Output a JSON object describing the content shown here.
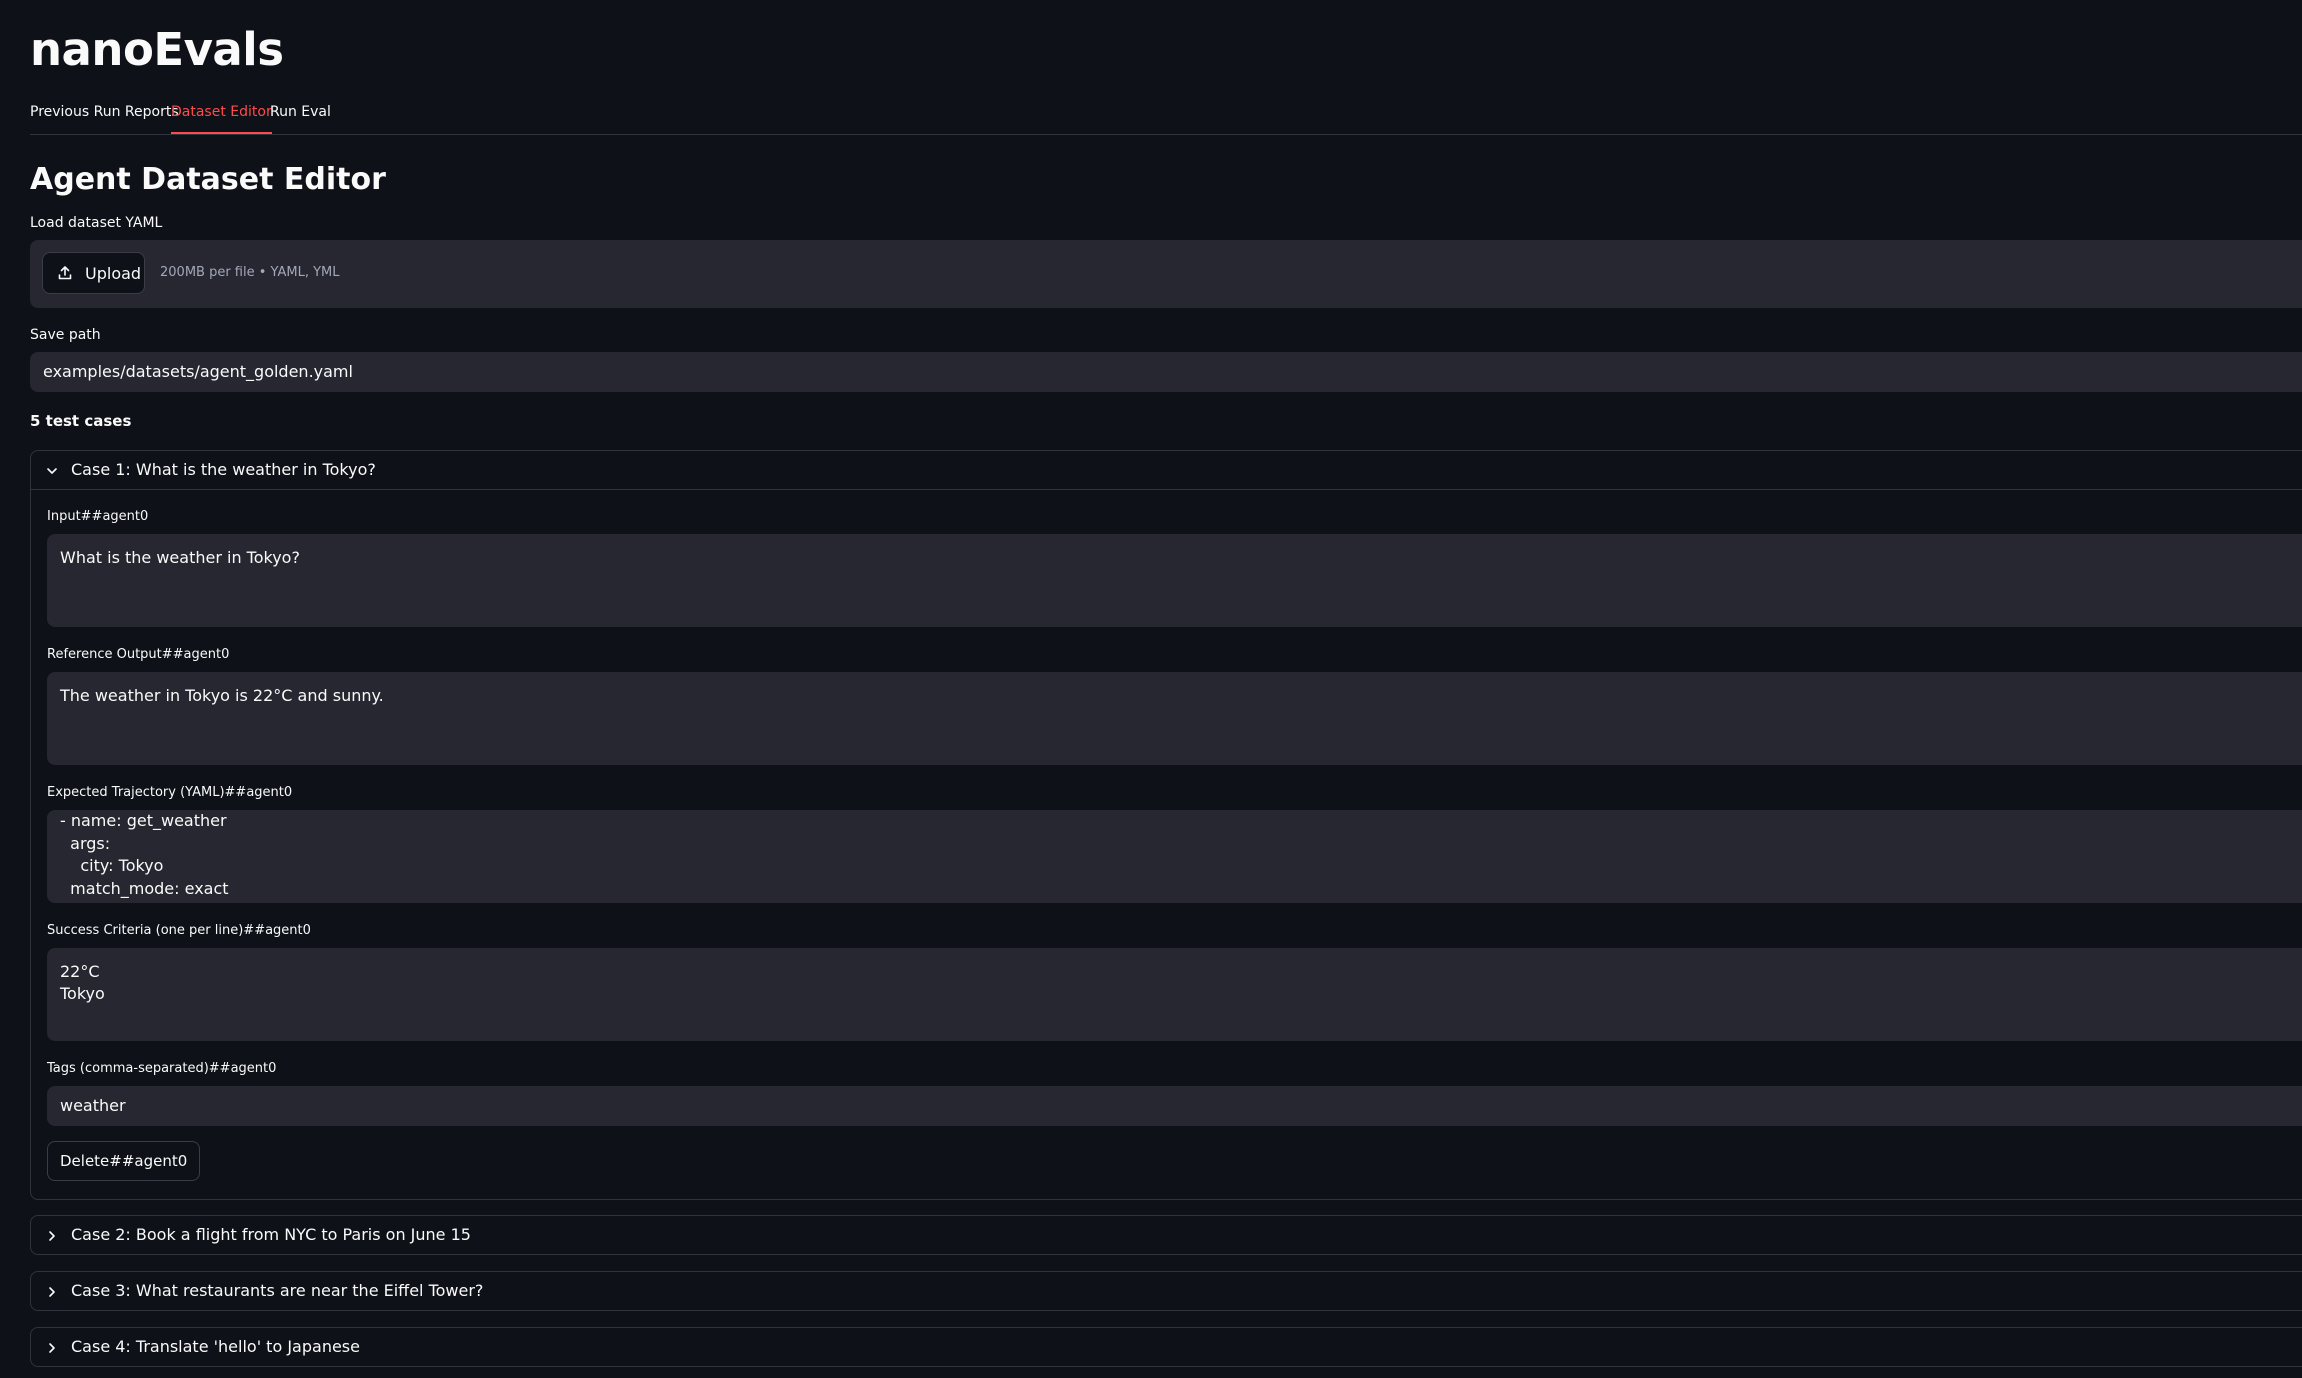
{
  "app": {
    "title": "nanoEvals"
  },
  "tabs": [
    {
      "label": "Previous Run Reports",
      "active": false
    },
    {
      "label": "Dataset Editor",
      "active": true
    },
    {
      "label": "Run Eval",
      "active": false
    }
  ],
  "editor": {
    "title": "Agent Dataset Editor",
    "load_label": "Load dataset YAML",
    "upload_button": "Upload",
    "upload_hint": "200MB per file • YAML, YML",
    "save_path_label": "Save path",
    "save_path_value": "examples/datasets/agent_golden.yaml",
    "count_label": "5 test cases"
  },
  "cases": [
    {
      "title": "Case 1: What is the weather in Tokyo?",
      "expanded": true,
      "input_label": "Input##agent0",
      "input_value": "What is the weather in Tokyo?",
      "reference_label": "Reference Output##agent0",
      "reference_value": "The weather in Tokyo is 22°C and sunny.",
      "trajectory_label": "Expected Trajectory (YAML)##agent0",
      "trajectory_value": "- name: get_weather\n  args:\n    city: Tokyo\n  match_mode: exact",
      "criteria_label": "Success Criteria (one per line)##agent0",
      "criteria_value": "22°C\nTokyo",
      "tags_label": "Tags (comma-separated)##agent0",
      "tags_value": "weather",
      "delete_label": "Delete##agent0"
    },
    {
      "title": "Case 2: Book a flight from NYC to Paris on June 15",
      "expanded": false
    },
    {
      "title": "Case 3: What restaurants are near the Eiffel Tower?",
      "expanded": false
    },
    {
      "title": "Case 4: Translate 'hello' to Japanese",
      "expanded": false
    }
  ],
  "icons": {
    "upload": "upload-icon",
    "expanded": "chevron-down-icon",
    "collapsed": "chevron-right-icon"
  },
  "colors": {
    "background": "#0e1117",
    "surface": "#262730",
    "accent": "#ff4b4b",
    "border": "#31333f",
    "muted_text": "#a3a8b8"
  }
}
